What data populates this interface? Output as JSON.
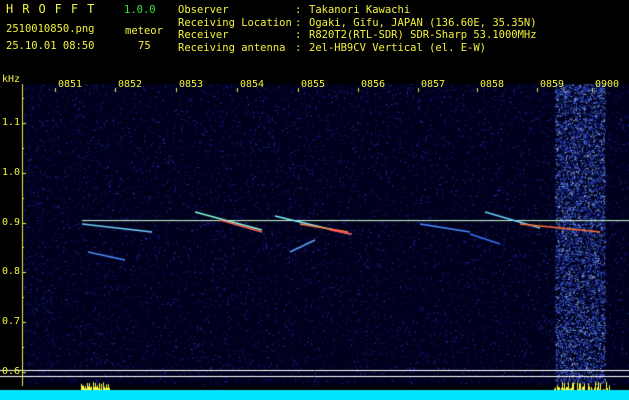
{
  "header": {
    "brand": "HROFFT",
    "version": "1.0.0",
    "filename": "2510010850.png",
    "datetime": "25.10.01 08:50",
    "meteor_label": "meteor",
    "meteor_count": "75",
    "info": [
      {
        "key": "Observer",
        "value": "Takanori Kawachi"
      },
      {
        "key": "Receiving Location",
        "value": "Ogaki, Gifu, JAPAN (136.60E, 35.35N)"
      },
      {
        "key": "Receiver",
        "value": "R820T2(RTL-SDR) SDR-Sharp 53.1000MHz"
      },
      {
        "key": "Receiving antenna",
        "value": "2el-HB9CV Vertical (el. E-W)"
      }
    ]
  },
  "chart_data": {
    "type": "heatmap",
    "ylabel": "kHz",
    "x_ticks": [
      "0851",
      "0852",
      "0853",
      "0854",
      "0855",
      "0856",
      "0857",
      "0858",
      "0859",
      "0900"
    ],
    "y_ticks": [
      "1.1",
      "1.0",
      "0.9",
      "0.8",
      "0.7",
      "0.6"
    ],
    "ylim": [
      0.575,
      1.175
    ],
    "carrier_khz": 0.905,
    "colors": {
      "axis": "#f2f23c",
      "background": "#000020",
      "carrier": "#d0ffd0",
      "level_bar": "#ffff40",
      "level_base": "#00e5ff"
    }
  }
}
